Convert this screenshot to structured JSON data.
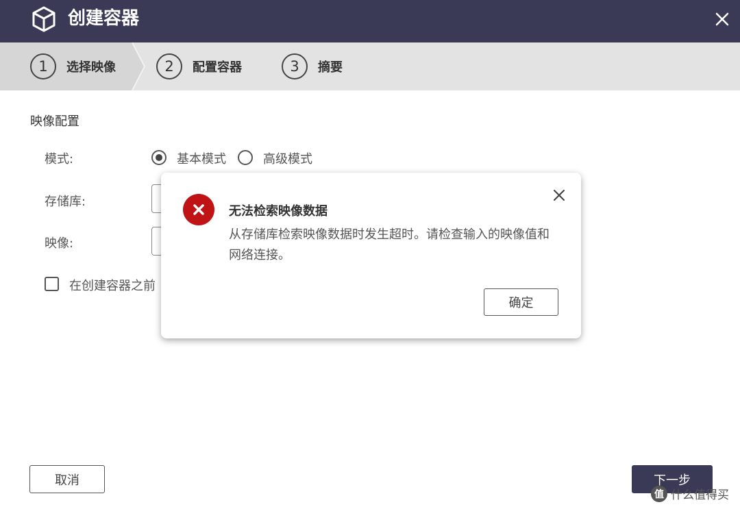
{
  "window": {
    "title": "创建容器",
    "close_icon": "close-icon",
    "title_icon": "cube-icon",
    "colors": {
      "titlebar": "#3b3a56",
      "error": "#c01316"
    }
  },
  "steps": [
    {
      "number": "1",
      "label": "选择映像",
      "active": true
    },
    {
      "number": "2",
      "label": "配置容器",
      "active": false
    },
    {
      "number": "3",
      "label": "摘要",
      "active": false
    }
  ],
  "form": {
    "section_title": "映像配置",
    "mode": {
      "label": "模式:",
      "options": [
        "基本模式",
        "高级模式"
      ],
      "selected": "基本模式"
    },
    "repository_label": "存储库:",
    "image_label": "映像:",
    "checkbox_label": "在创建容器之前"
  },
  "dialog": {
    "icon": "error-icon",
    "title": "无法检索映像数据",
    "message": "从存储库检索映像数据时发生超时。请检查输入的映像值和网络连接。",
    "ok_label": "确定"
  },
  "footer": {
    "cancel_label": "取消",
    "next_label": "下一步"
  },
  "watermark": {
    "badge": "值",
    "text": "什么值得买"
  }
}
